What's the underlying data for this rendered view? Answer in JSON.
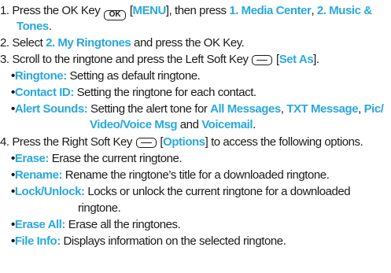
{
  "steps": [
    {
      "num": "1.",
      "line1": {
        "t1": "Press the OK Key",
        "ok_key": "OK",
        "t2": "[",
        "menu": "MENU",
        "t3": "], then press",
        "media_center": "1. Media Center",
        "t4": ",",
        "music_tones_a": "2. Music &"
      },
      "line2": {
        "music_tones_b": "Tones",
        "t1": "."
      }
    },
    {
      "num": "2.",
      "line1": {
        "t1": "Select",
        "my_ringtones": "2. My Ringtones",
        "t2": "and press the OK Key."
      }
    },
    {
      "num": "3.",
      "line1": {
        "t1": "Scroll to the ringtone and press the Left Soft Key",
        "t2": "[",
        "set_as": "Set As",
        "t3": "]."
      },
      "bullets": [
        {
          "label": "Ringtone:",
          "text": "Setting as default ringtone."
        },
        {
          "label": "Contact ID:",
          "text": "Setting the ringtone for each contact."
        },
        {
          "label": "Alert Sounds:",
          "text1": "Setting the alert tone for",
          "all_messages": "All Messages",
          "sep1": ",",
          "txt_message": "TXT Message",
          "sep2": ",",
          "pic_a": "Pic/",
          "pic_b": "Video/Voice Msg",
          "and": "and",
          "voicemail": "Voicemail",
          "end": "."
        }
      ]
    },
    {
      "num": "4.",
      "line1": {
        "t1": "Press the Right Soft Key",
        "t2": "[",
        "options": "Options",
        "t3": "] to access the following options."
      },
      "bullets": [
        {
          "label": "Erase:",
          "text": "Erase the current ringtone."
        },
        {
          "label": "Rename:",
          "text": "Rename the ringtone’s title for a downloaded ringtone."
        },
        {
          "label": "Lock/Unlock:",
          "text1": "Locks or unlock the current ringtone for a downloaded",
          "text2": "ringtone."
        },
        {
          "label": "Erase All:",
          "text": "Erase all the ringtones."
        },
        {
          "label": "File Info:",
          "text": "Displays information on the selected ringtone."
        }
      ]
    }
  ],
  "bullet_char": "•",
  "colors": {
    "highlight": "#2aa8df",
    "text": "#1a1a1a"
  },
  "icons": {
    "ok_key": "ok-key-icon",
    "left_soft_key": "soft-key-icon",
    "right_soft_key": "soft-key-icon"
  }
}
